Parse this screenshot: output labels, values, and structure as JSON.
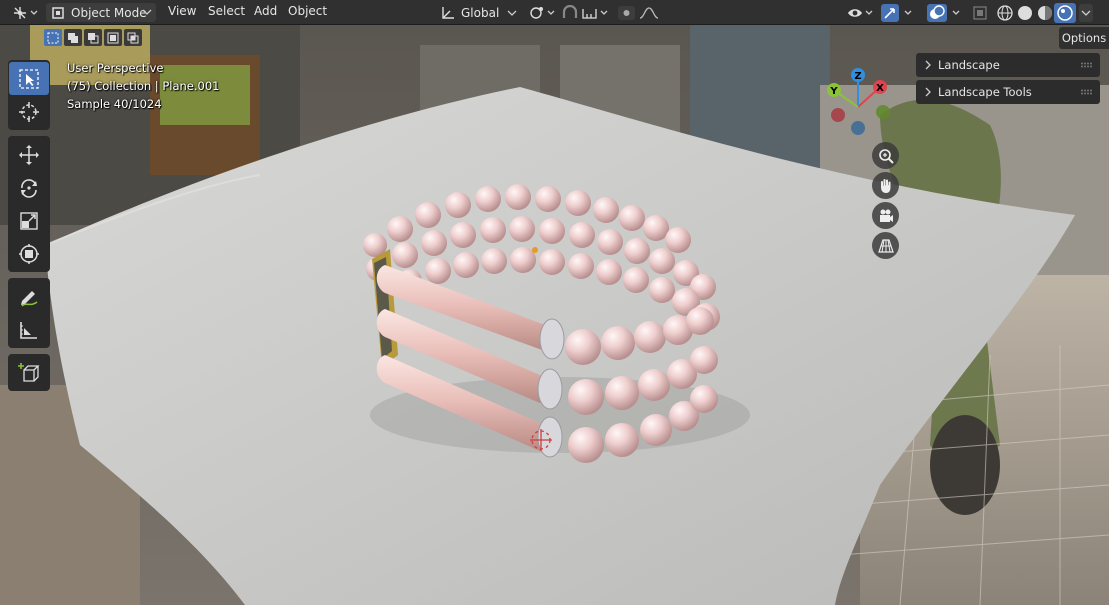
{
  "header": {
    "editor_type_icon": "viewport-icon",
    "mode": "Object Mode",
    "menus": [
      "View",
      "Select",
      "Add",
      "Object"
    ],
    "orientation": "Global"
  },
  "viewport": {
    "info_lines": [
      "User Perspective",
      "(75) Collection | Plane.001",
      "Sample 40/1024"
    ],
    "options_label": "Options",
    "panels": [
      "Landscape",
      "Landscape Tools"
    ],
    "gizmo_axes": [
      "X",
      "Y",
      "Z"
    ]
  },
  "toolbar": {
    "tools": [
      "select-box",
      "cursor",
      "move",
      "rotate",
      "scale",
      "transform",
      "annotate",
      "measure",
      "add-cube"
    ]
  },
  "colors": {
    "accent": "#4772b3",
    "header_bg": "#303030",
    "axis_x": "#e0434f",
    "axis_y": "#8ac23a",
    "axis_z": "#2f8fe0"
  }
}
